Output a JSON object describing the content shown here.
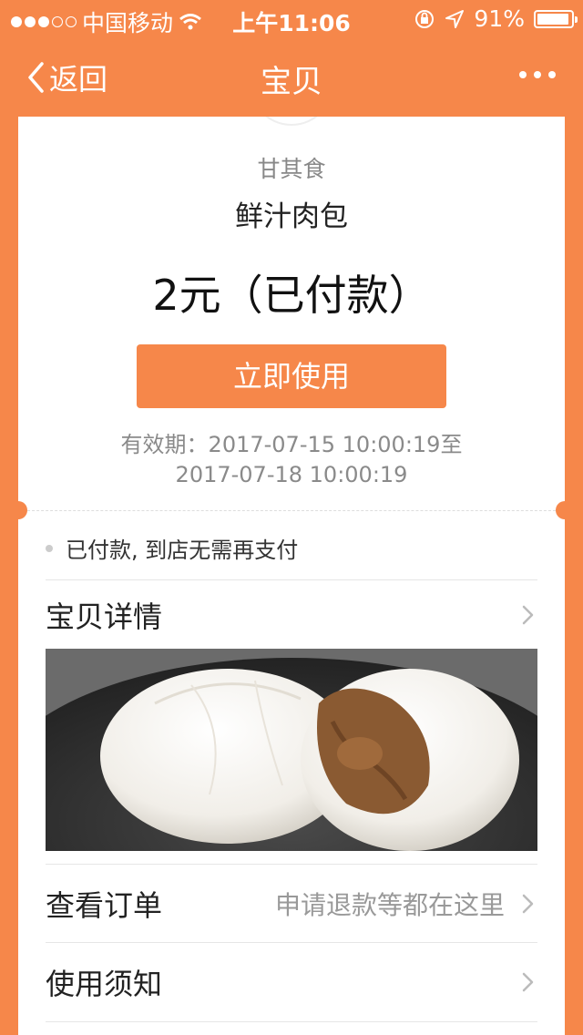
{
  "status_bar": {
    "carrier": "中国移动",
    "time": "上午11:06",
    "battery": "91%",
    "battery_level": 0.91
  },
  "nav": {
    "back_label": "返回",
    "title": "宝贝"
  },
  "card": {
    "shop_name": "甘其食",
    "product_name": "鲜汁肉包",
    "price_text": "2元（已付款）",
    "use_button": "立即使用",
    "validity_line1": "有效期：2017-07-15 10:00:19至",
    "validity_line2": "2017-07-18 10:00:19",
    "note": "已付款, 到店无需再支付"
  },
  "rows": {
    "details": {
      "label": "宝贝详情"
    },
    "orders": {
      "label": "查看订单",
      "hint": "申请退款等都在这里"
    },
    "notice": {
      "label": "使用须知"
    }
  },
  "colors": {
    "accent": "#F6874A",
    "card": "#FFFFFF"
  }
}
